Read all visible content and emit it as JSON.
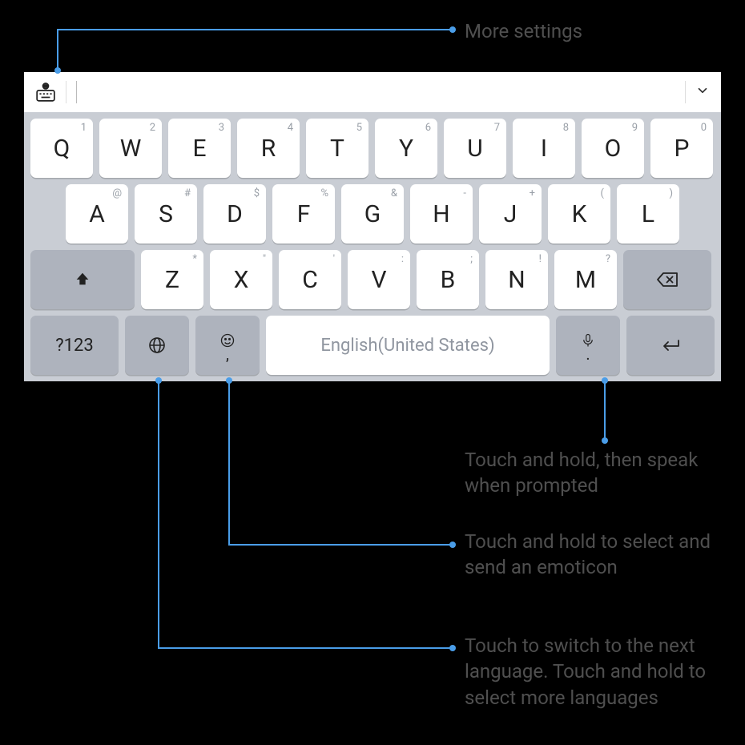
{
  "callouts": {
    "more_settings": "More settings",
    "speak": "Touch and hold, then speak when prompted",
    "emoticon": "Touch and hold to select and send an emoticon",
    "language": "Touch to switch to the next language. Touch and hold to select more languages"
  },
  "keyboard": {
    "row1": [
      {
        "main": "Q",
        "sup": "1"
      },
      {
        "main": "W",
        "sup": "2"
      },
      {
        "main": "E",
        "sup": "3"
      },
      {
        "main": "R",
        "sup": "4"
      },
      {
        "main": "T",
        "sup": "5"
      },
      {
        "main": "Y",
        "sup": "6"
      },
      {
        "main": "U",
        "sup": "7"
      },
      {
        "main": "I",
        "sup": "8"
      },
      {
        "main": "O",
        "sup": "9"
      },
      {
        "main": "P",
        "sup": "0"
      }
    ],
    "row2": [
      {
        "main": "A",
        "sup": "@"
      },
      {
        "main": "S",
        "sup": "#"
      },
      {
        "main": "D",
        "sup": "$"
      },
      {
        "main": "F",
        "sup": "%"
      },
      {
        "main": "G",
        "sup": "&"
      },
      {
        "main": "H",
        "sup": "-"
      },
      {
        "main": "J",
        "sup": "+"
      },
      {
        "main": "K",
        "sup": "("
      },
      {
        "main": "L",
        "sup": ")"
      }
    ],
    "row3": [
      {
        "main": "Z",
        "sup": "*"
      },
      {
        "main": "X",
        "sup": "\""
      },
      {
        "main": "C",
        "sup": "'"
      },
      {
        "main": "V",
        "sup": ":"
      },
      {
        "main": "B",
        "sup": ";"
      },
      {
        "main": "N",
        "sup": "!"
      },
      {
        "main": "M",
        "sup": "?"
      }
    ],
    "numbers_label": "?123",
    "space_label": "English(United States)",
    "comma": ",",
    "period": "."
  }
}
